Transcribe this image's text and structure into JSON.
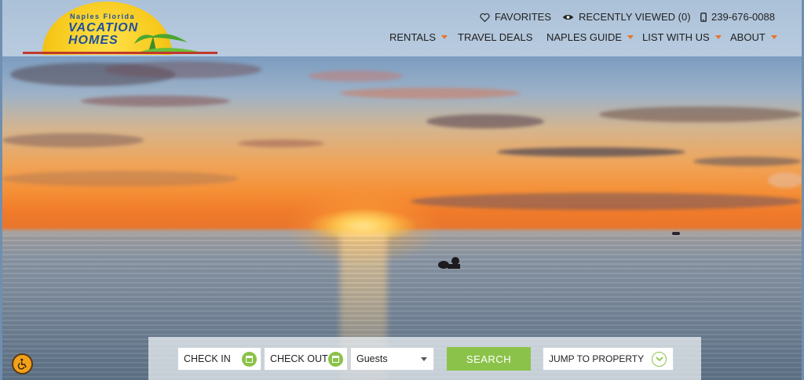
{
  "logo": {
    "top_text": "Naples Florida",
    "line1": "VACATION",
    "line2": "HOMES"
  },
  "utility": {
    "favorites": "FAVORITES",
    "recently_viewed": "RECENTLY VIEWED (0)",
    "phone": "239-676-0088"
  },
  "nav": {
    "items": [
      {
        "label": "RENTALS",
        "dropdown": true
      },
      {
        "label": "TRAVEL DEALS",
        "dropdown": false
      },
      {
        "label": "NAPLES GUIDE",
        "dropdown": true
      },
      {
        "label": "LIST WITH US",
        "dropdown": true
      },
      {
        "label": "ABOUT",
        "dropdown": true
      }
    ]
  },
  "search": {
    "check_in": "CHECK IN",
    "check_out": "CHECK OUT",
    "guests": "Guests",
    "search_button": "SEARCH",
    "jump_to_property": "JUMP TO PROPERTY"
  },
  "colors": {
    "accent_orange": "#e8742b",
    "accent_green": "#8bc34a",
    "logo_blue": "#1f4f9e"
  },
  "icons": {
    "favorites": "heart-icon",
    "recently_viewed": "eye-icon",
    "phone": "phone-icon",
    "calendar": "calendar-icon",
    "guests": "dropdown-arrow-icon",
    "jump": "chevron-down-icon",
    "accessibility": "accessibility-icon"
  }
}
